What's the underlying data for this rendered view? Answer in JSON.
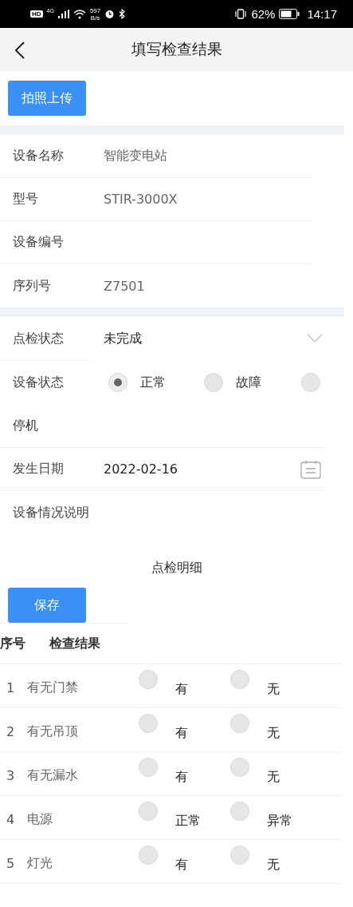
{
  "status_bar": {
    "hd": "HD",
    "network": "4G",
    "speed_value": "597",
    "speed_unit": "B/s",
    "battery": "62%",
    "time": "14:17"
  },
  "header": {
    "title": "填写检查结果"
  },
  "upload_button": "拍照上传",
  "device_info": [
    {
      "label": "设备名称",
      "value": "智能变电站"
    },
    {
      "label": "型号",
      "value": "STIR-3000X"
    },
    {
      "label": "设备编号"
    },
    {
      "label": "序列号",
      "value": "Z7501"
    }
  ],
  "inspection_status": {
    "label": "点检状态",
    "value": "未完成"
  },
  "device_status": {
    "label": "设备状态",
    "options": [
      {
        "label": "正常",
        "selected": true
      },
      {
        "label": "故障",
        "selected": false
      },
      {
        "label": "停机",
        "selected": false
      }
    ]
  },
  "occurrence_date": {
    "label": "发生日期",
    "value": "2022-02-16"
  },
  "description": {
    "label": "设备情况说明"
  },
  "detail_title": "点检明细",
  "save_button": "保存",
  "table": {
    "columns": [
      "序号",
      "检查结果"
    ],
    "rows": [
      {
        "no": "1",
        "item": "有无门禁",
        "options": [
          {
            "label": "有",
            "selected": false
          },
          {
            "label": "无",
            "selected": false
          }
        ]
      },
      {
        "no": "2",
        "item": "有无吊顶",
        "options": [
          {
            "label": "有",
            "selected": false
          },
          {
            "label": "无",
            "selected": false
          }
        ]
      },
      {
        "no": "3",
        "item": "有无漏水",
        "options": [
          {
            "label": "有",
            "selected": false
          },
          {
            "label": "无",
            "selected": false
          }
        ]
      },
      {
        "no": "4",
        "item": "电源",
        "options": [
          {
            "label": "正常",
            "selected": false
          },
          {
            "label": "异常",
            "selected": false
          }
        ]
      },
      {
        "no": "5",
        "item": "灯光",
        "options": [
          {
            "label": "有",
            "selected": false
          },
          {
            "label": "无",
            "selected": false
          }
        ]
      }
    ]
  }
}
